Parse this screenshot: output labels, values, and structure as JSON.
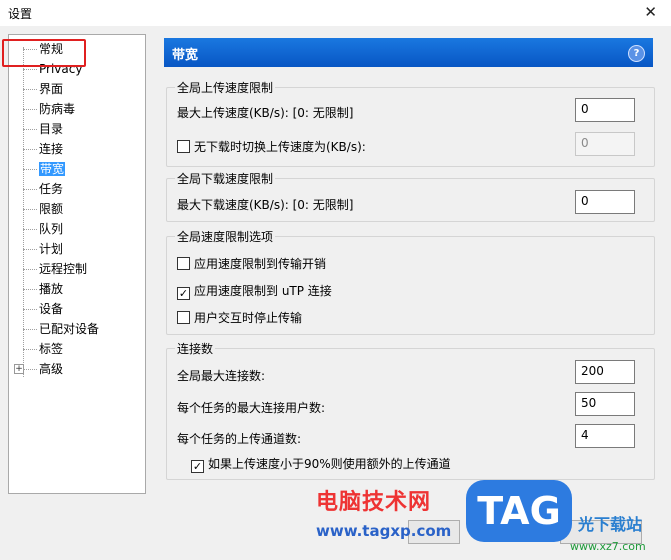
{
  "window": {
    "title": "设置",
    "close_glyph": "✕"
  },
  "tree": {
    "items": [
      {
        "label": "常规"
      },
      {
        "label": "Privacy"
      },
      {
        "label": "界面"
      },
      {
        "label": "防病毒"
      },
      {
        "label": "目录"
      },
      {
        "label": "连接"
      },
      {
        "label": "带宽"
      },
      {
        "label": "任务"
      },
      {
        "label": "限额"
      },
      {
        "label": "队列"
      },
      {
        "label": "计划"
      },
      {
        "label": "远程控制"
      },
      {
        "label": "播放"
      },
      {
        "label": "设备"
      },
      {
        "label": "已配对设备"
      },
      {
        "label": "标签"
      },
      {
        "label": "高级"
      }
    ],
    "selected_index": 6,
    "expander_glyph": "+"
  },
  "panel": {
    "title": "带宽",
    "help_glyph": "?"
  },
  "upload_group": {
    "label": "全局上传速度限制",
    "max_upload_label": "最大上传速度(KB/s): [0: 无限制]",
    "max_upload_value": "0",
    "alt_upload_label": "无下载时切换上传速度为(KB/s):",
    "alt_upload_checked": false,
    "alt_upload_value": "0"
  },
  "download_group": {
    "label": "全局下载速度限制",
    "max_download_label": "最大下载速度(KB/s): [0: 无限制]",
    "max_download_value": "0"
  },
  "limit_options_group": {
    "label": "全局速度限制选项",
    "opt1_label": "应用速度限制到传输开销",
    "opt1_checked": false,
    "opt2_label": "应用速度限制到 uTP 连接",
    "opt2_checked": true,
    "opt3_label": "用户交互时停止传输",
    "opt3_checked": false
  },
  "connections_group": {
    "label": "连接数",
    "global_max_label": "全局最大连接数:",
    "global_max_value": "200",
    "per_task_peers_label": "每个任务的最大连接用户数:",
    "per_task_peers_value": "50",
    "upload_slots_label": "每个任务的上传通道数:",
    "upload_slots_value": "4",
    "extra_slots_label": "如果上传速度小于90%则使用额外的上传通道",
    "extra_slots_checked": true
  },
  "watermark": {
    "site_name": "电脑技术网",
    "url": "www.tagxp.com",
    "logo": "TAG",
    "site2": "光下载站",
    "site2_url": "www.xz7.com"
  },
  "colors": {
    "header_blue": "#0a64d0",
    "selection": "#3399ff",
    "highlight_box": "#e02020"
  }
}
